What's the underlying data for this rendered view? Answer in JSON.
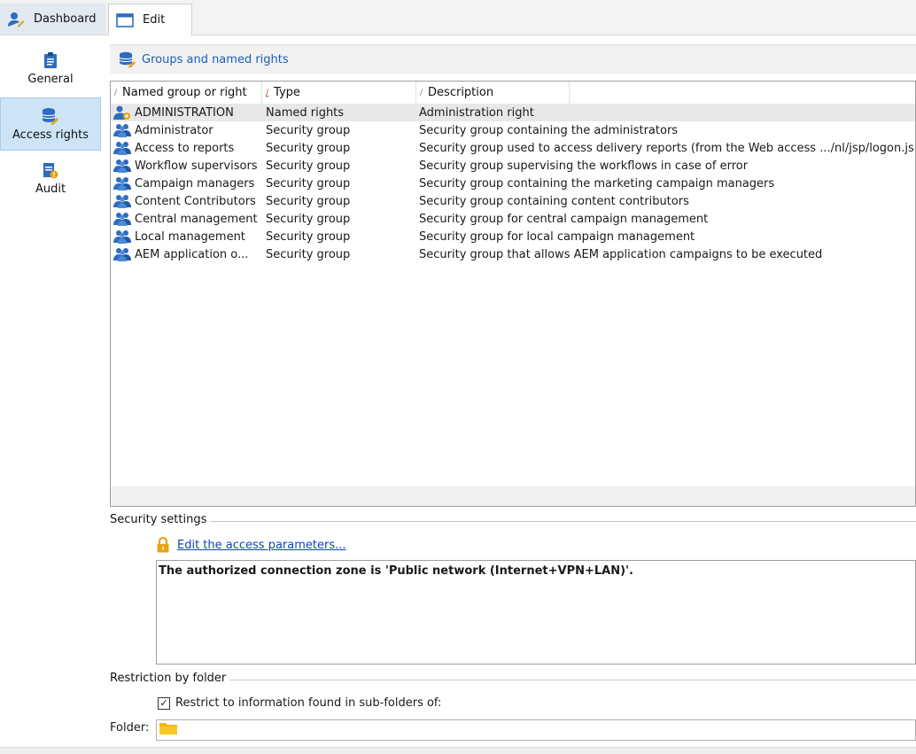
{
  "tabs": [
    {
      "label": "Dashboard",
      "icon": "user-edit-icon"
    },
    {
      "label": "Edit",
      "icon": "window-icon"
    }
  ],
  "nav": [
    {
      "label": "General",
      "icon": "clipboard-icon"
    },
    {
      "label": "Access rights",
      "icon": "database-edit-icon"
    },
    {
      "label": "Audit",
      "icon": "audit-icon"
    }
  ],
  "section": {
    "title": "Groups and named rights"
  },
  "grid": {
    "columns": [
      "Named group or right",
      "Type",
      "Description"
    ],
    "rows": [
      {
        "name": "ADMINISTRATION",
        "type": "Named rights",
        "description": "Administration right",
        "icon": "named-right-icon"
      },
      {
        "name": "Administrator",
        "type": "Security group",
        "description": "Security group containing the administrators",
        "icon": "group-icon"
      },
      {
        "name": "Access to reports",
        "type": "Security group",
        "description": "Security group used to access delivery reports (from the Web access .../nl/jsp/logon.js",
        "icon": "group-icon"
      },
      {
        "name": "Workflow supervisors",
        "type": "Security group",
        "description": "Security group supervising the workflows in case of error",
        "icon": "group-icon"
      },
      {
        "name": "Campaign managers",
        "type": "Security group",
        "description": "Security group containing the marketing campaign managers",
        "icon": "group-icon"
      },
      {
        "name": "Content Contributors",
        "type": "Security group",
        "description": "Security group containing content contributors",
        "icon": "group-icon"
      },
      {
        "name": "Central management",
        "type": "Security group",
        "description": "Security group for central campaign management",
        "icon": "group-icon"
      },
      {
        "name": "Local management",
        "type": "Security group",
        "description": "Security group for local campaign management",
        "icon": "group-icon"
      },
      {
        "name": "AEM application o...",
        "type": "Security group",
        "description": "Security group that allows AEM application campaigns to be executed",
        "icon": "group-icon"
      }
    ]
  },
  "security": {
    "legend": "Security settings",
    "link": "Edit the access parameters...",
    "info": "The authorized connection zone is 'Public network (Internet+VPN+LAN)'."
  },
  "restriction": {
    "legend": "Restriction by folder",
    "checkbox_label": "Restrict to information found in sub-folders of:",
    "checked": true,
    "folder_label": "Folder:"
  },
  "colors": {
    "accent": "#1a5fb4",
    "link": "#0b3fd6",
    "selected_nav": "#cde4f7",
    "folder": "#f2b705"
  }
}
